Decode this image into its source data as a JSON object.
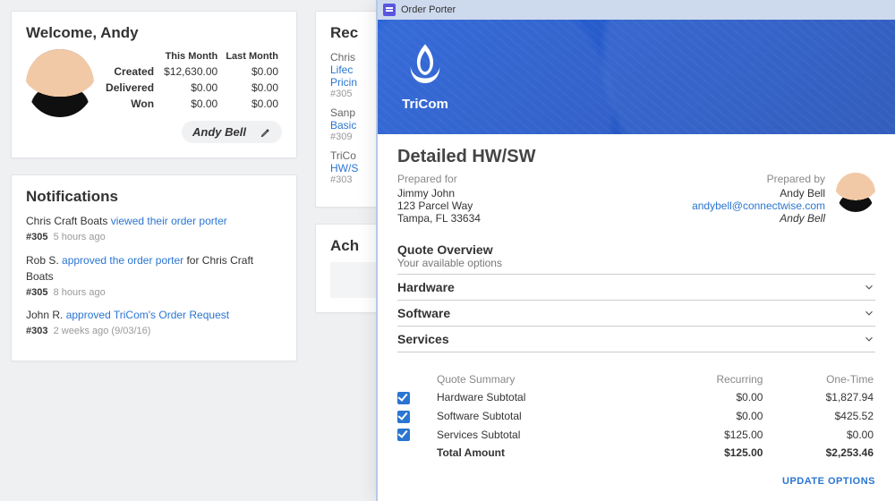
{
  "welcome": {
    "heading": "Welcome, Andy",
    "headers": {
      "c1": "This Month",
      "c2": "Last Month"
    },
    "rows": [
      {
        "label": "Created",
        "c1": "$12,630.00",
        "c2": "$0.00"
      },
      {
        "label": "Delivered",
        "c1": "$0.00",
        "c2": "$0.00"
      },
      {
        "label": "Won",
        "c1": "$0.00",
        "c2": "$0.00"
      }
    ],
    "name": "Andy Bell"
  },
  "notifications": {
    "heading": "Notifications",
    "items": [
      {
        "who": "Chris Craft Boats",
        "action": "viewed their order porter",
        "suffix": "",
        "tag": "#305",
        "when": "5 hours ago"
      },
      {
        "who": "Rob S.",
        "action": "approved the order porter",
        "suffix": " for Chris Craft Boats",
        "tag": "#305",
        "when": "8 hours ago"
      },
      {
        "who": "John R.",
        "action": "approved TriCom's Order Request",
        "suffix": "",
        "tag": "#303",
        "when": "2 weeks ago (9/03/16)"
      }
    ]
  },
  "recent": {
    "heading": "Rec",
    "items": [
      {
        "top": "Chris",
        "link1": "Lifec",
        "link2": "Pricin",
        "tag": "#305"
      },
      {
        "top": "Sanp",
        "link1": "Basic",
        "link2": "",
        "tag": "#309"
      },
      {
        "top": "TriCo",
        "link1": "HW/S",
        "link2": "",
        "tag": "#303"
      }
    ]
  },
  "achievements": {
    "heading": "Ach"
  },
  "orderPorter": {
    "windowTitle": "Order Porter",
    "brand": "TriCom",
    "title": "Detailed HW/SW",
    "preparedForLabel": "Prepared for",
    "preparedFor": {
      "name": "Jimmy John",
      "addr1": "123 Parcel Way",
      "addr2": "Tampa, FL 33634"
    },
    "preparedByLabel": "Prepared by",
    "preparedBy": {
      "name": "Andy Bell",
      "email": "andybell@connectwise.com",
      "sig": "Andy Bell"
    },
    "quoteOverview": {
      "title": "Quote Overview",
      "sub": "Your available options"
    },
    "sections": [
      {
        "label": "Hardware"
      },
      {
        "label": "Software"
      },
      {
        "label": "Services"
      }
    ],
    "summary": {
      "head": {
        "label": "Quote Summary",
        "c1": "Recurring",
        "c2": "One-Time"
      },
      "rows": [
        {
          "checked": true,
          "label": "Hardware Subtotal",
          "c1": "$0.00",
          "c2": "$1,827.94"
        },
        {
          "checked": true,
          "label": "Software Subtotal",
          "c1": "$0.00",
          "c2": "$425.52"
        },
        {
          "checked": true,
          "label": "Services Subtotal",
          "c1": "$125.00",
          "c2": "$0.00"
        }
      ],
      "total": {
        "label": "Total Amount",
        "c1": "$125.00",
        "c2": "$2,253.46"
      }
    },
    "updateButton": "UPDATE OPTIONS"
  }
}
